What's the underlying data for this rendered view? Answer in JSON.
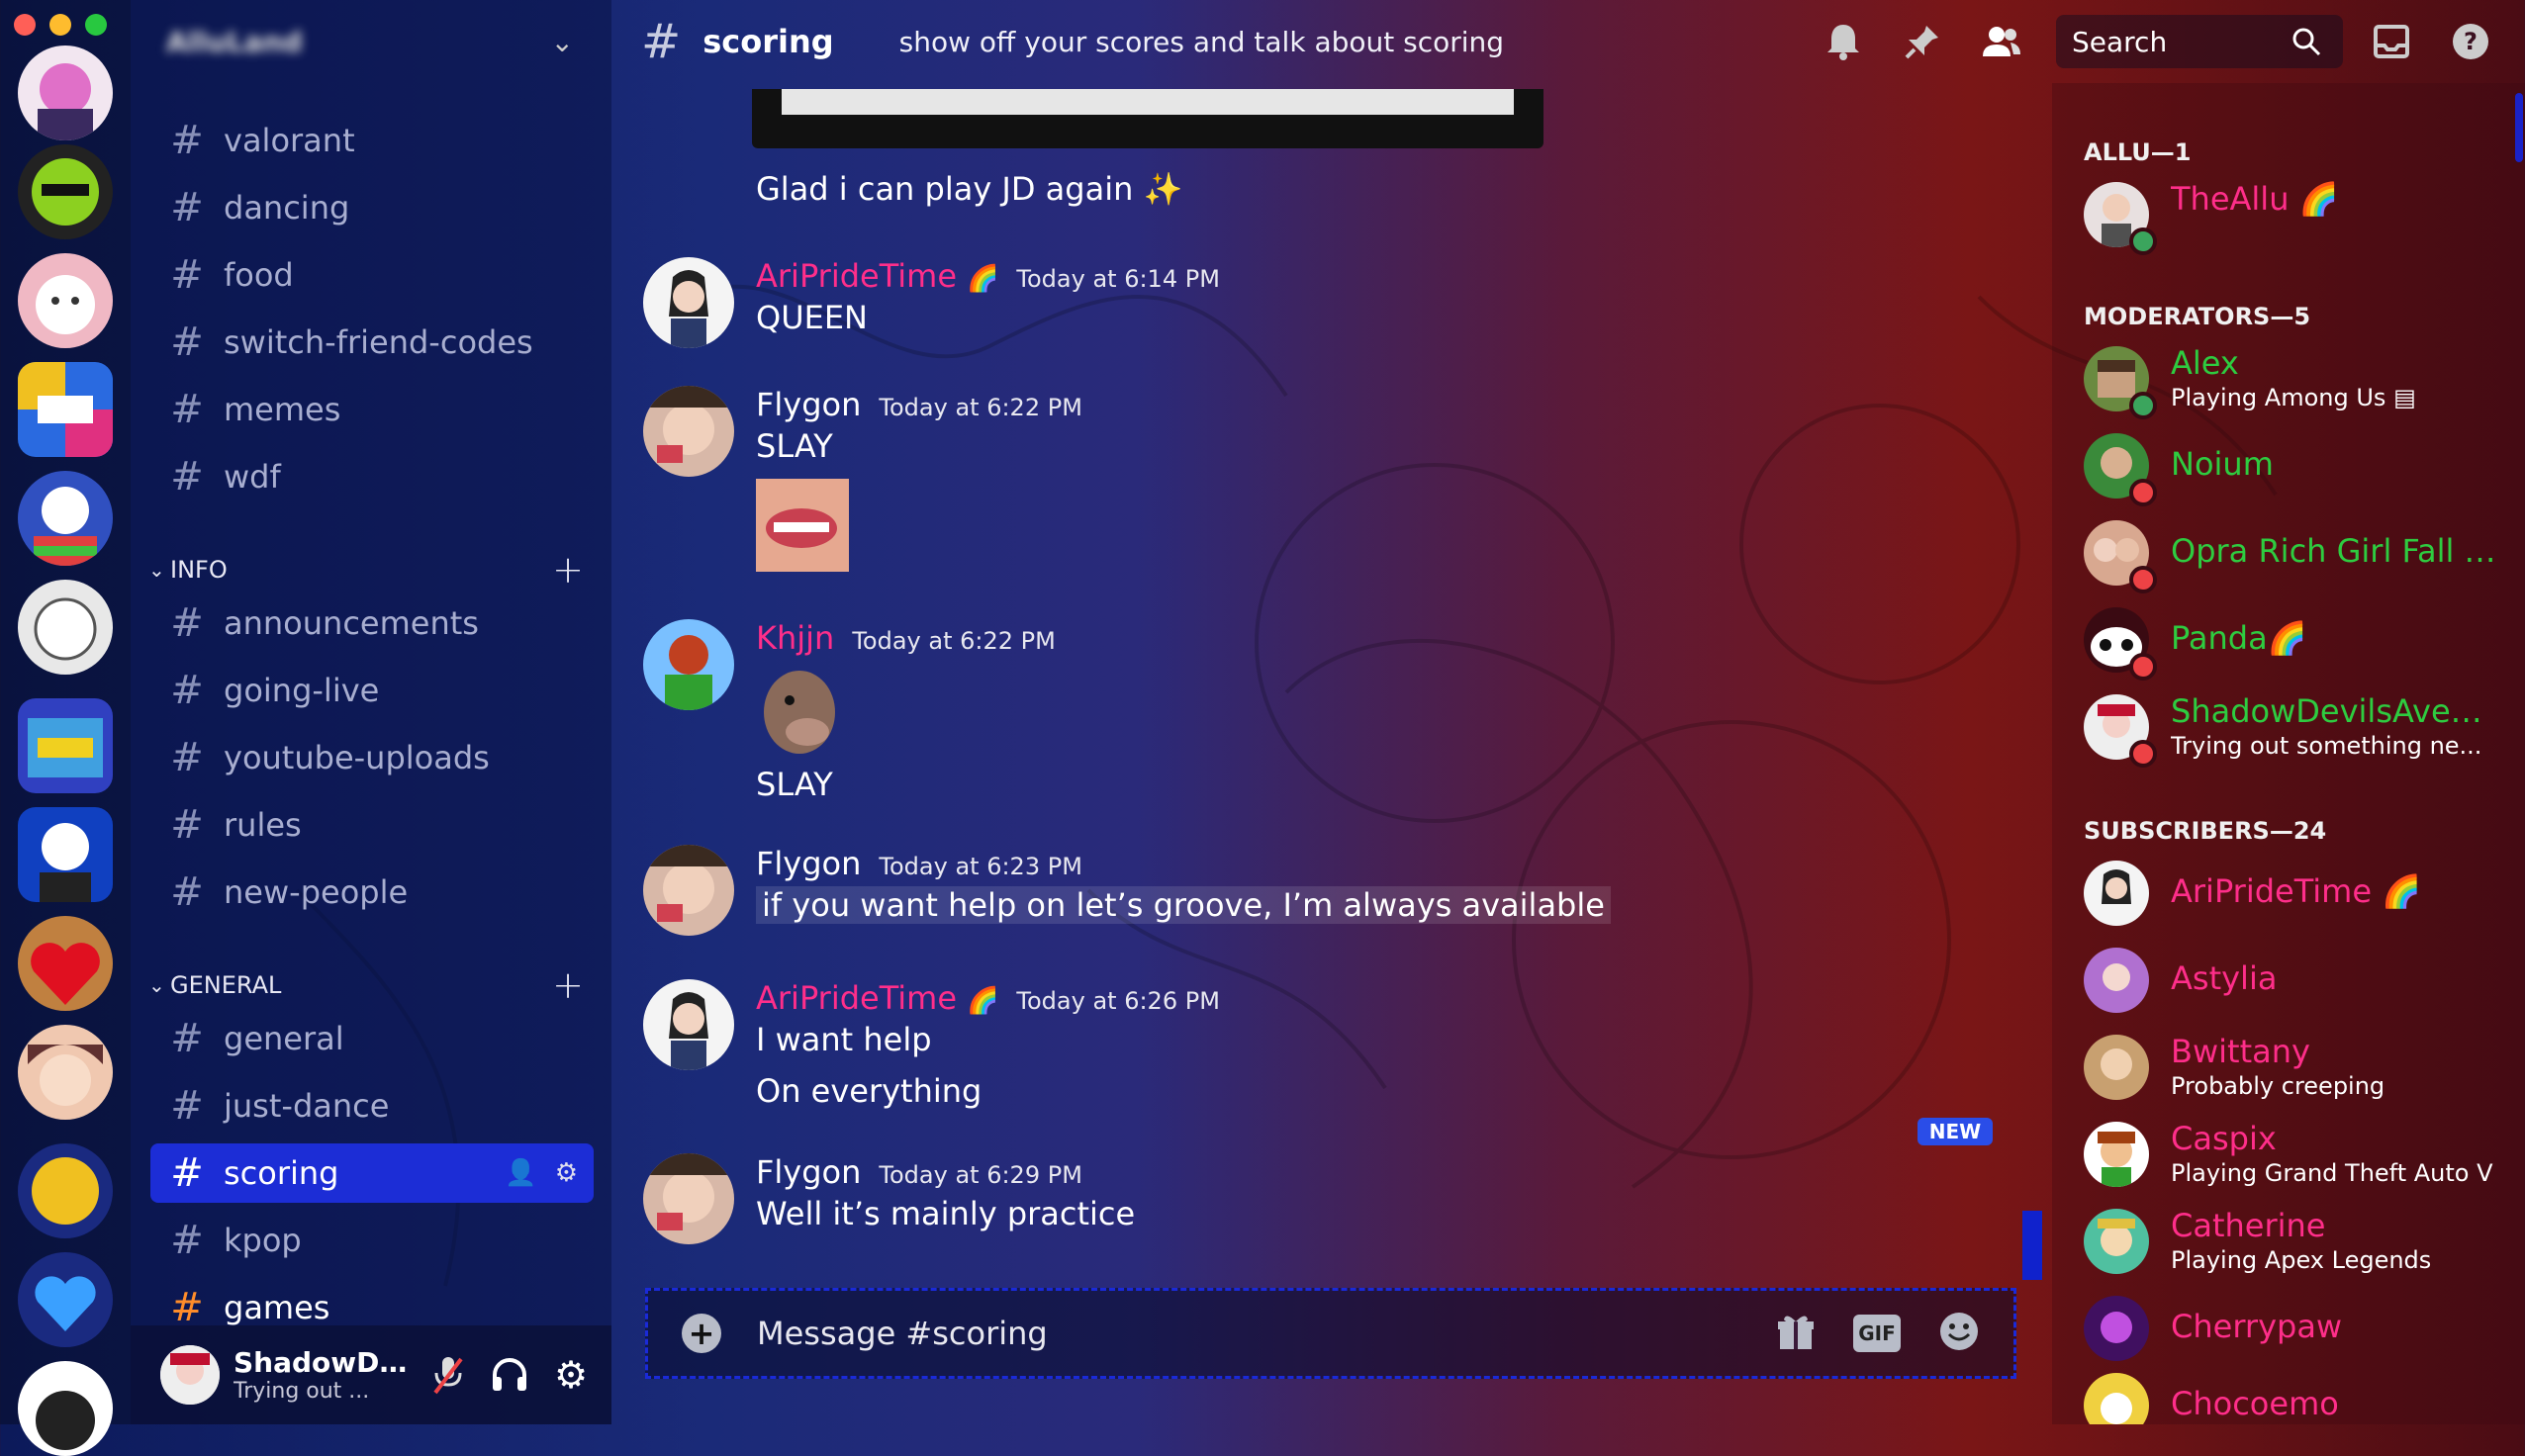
{
  "colors": {
    "accent": "#1c2dd6",
    "pink": "#ff2e8a",
    "green": "#2ecc40",
    "red": "#ff4d5a",
    "online": "#3ba55d",
    "dnd": "#ed4245"
  },
  "server": {
    "name": "AlluLand"
  },
  "channels_top": [
    {
      "name": "valorant"
    },
    {
      "name": "dancing"
    },
    {
      "name": "food"
    },
    {
      "name": "switch-friend-codes"
    },
    {
      "name": "memes"
    },
    {
      "name": "wdf"
    }
  ],
  "categories": {
    "info": "INFO",
    "general": "GENERAL"
  },
  "channels_info": [
    {
      "name": "announcements"
    },
    {
      "name": "going-live"
    },
    {
      "name": "youtube-uploads"
    },
    {
      "name": "rules"
    },
    {
      "name": "new-people"
    }
  ],
  "channels_general": [
    {
      "name": "general"
    },
    {
      "name": "just-dance"
    },
    {
      "name": "scoring"
    },
    {
      "name": "kpop"
    },
    {
      "name": "games"
    }
  ],
  "user": {
    "name": "ShadowDe...",
    "status": "Trying out ..."
  },
  "topbar": {
    "hash": "#",
    "channel": "scoring",
    "topic": "show off your scores and talk about scoring",
    "search_placeholder": "Search"
  },
  "messages": [
    {
      "lines": [
        "Glad i can play JD again ✨"
      ]
    },
    {
      "author": "AriPrideTime",
      "badge": "🌈",
      "time": "Today at 6:14 PM",
      "lines": [
        "QUEEN"
      ]
    },
    {
      "author": "Flygon",
      "time": "Today at 6:22 PM",
      "lines": [
        "SLAY"
      ]
    },
    {
      "author": "Khjjn",
      "time": "Today at 6:22 PM",
      "lines": [
        "SLAY"
      ]
    },
    {
      "author": "Flygon",
      "time": "Today at 6:23 PM",
      "lines": [
        "if you want help on let’s groove, I’m always available"
      ]
    },
    {
      "author": "AriPrideTime",
      "badge": "🌈",
      "time": "Today at 6:26 PM",
      "lines": [
        "I want help",
        "On everything"
      ]
    },
    {
      "author": "Flygon",
      "time": "Today at 6:29 PM",
      "lines": [
        "Well it’s mainly practice"
      ]
    }
  ],
  "new_badge": "NEW",
  "composer": {
    "placeholder": "Message #scoring",
    "gif": "GIF"
  },
  "members": {
    "groups": [
      {
        "title": "ALLU—1",
        "items": [
          {
            "name": "TheAllu",
            "badge": "🌈",
            "color": "#ff2e8a"
          }
        ]
      },
      {
        "title": "MODERATORS—5",
        "items": [
          {
            "name": "Alex",
            "status": "Playing Among Us",
            "color": "#2ecc40"
          },
          {
            "name": "Noium",
            "color": "#2ecc40"
          },
          {
            "name": "Opra Rich Girl Fall Ve...",
            "color": "#2ecc40"
          },
          {
            "name": "Panda",
            "badge": "🌈",
            "color": "#2ecc40"
          },
          {
            "name": "ShadowDevilsAveng...",
            "status": "Trying out something ne...",
            "color": "#2ecc40"
          }
        ]
      },
      {
        "title": "SUBSCRIBERS—24",
        "items": [
          {
            "name": "AriPrideTime",
            "badge": "🌈",
            "color": "#ff2e8a"
          },
          {
            "name": "Astylia",
            "color": "#ff2e8a"
          },
          {
            "name": "Bwittany",
            "status": "Probably creeping",
            "color": "#ff2e8a"
          },
          {
            "name": "Caspix",
            "status": "Playing Grand Theft Auto V",
            "color": "#ff2e8a"
          },
          {
            "name": "Catherine",
            "status": "Playing Apex Legends",
            "color": "#ff2e8a"
          },
          {
            "name": "Cherrypaw",
            "color": "#ff2e8a"
          },
          {
            "name": "Chocoemo",
            "color": "#ff2e8a"
          }
        ]
      }
    ]
  }
}
